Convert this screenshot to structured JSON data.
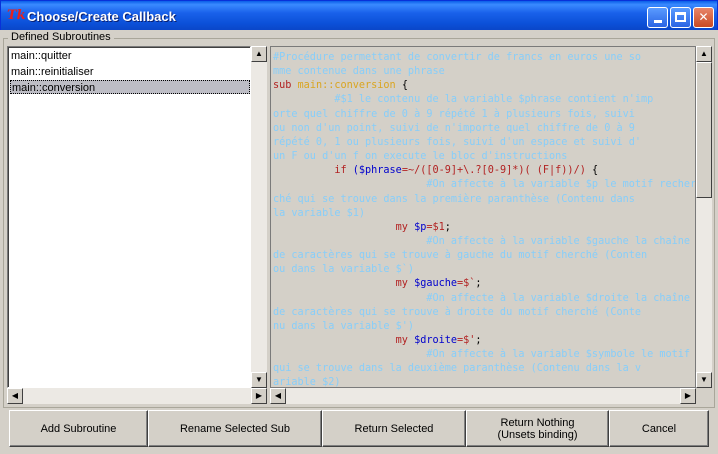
{
  "window": {
    "title": "Choose/Create Callback",
    "icon_text": "Tk",
    "controls": {
      "minimize": "minimize",
      "maximize": "maximize",
      "close": "✕"
    }
  },
  "frame": {
    "legend": "Defined Subroutines"
  },
  "subroutines": [
    {
      "label": "main::quitter",
      "selected": false
    },
    {
      "label": "main::reinitialiser",
      "selected": false
    },
    {
      "label": "main::conversion",
      "selected": true
    }
  ],
  "code": {
    "lines": [
      [
        [
          "c",
          "#Procédure permettant de convertir de francs en euros une so"
        ]
      ],
      [
        [
          "c",
          "mme contenue dans une phrase"
        ]
      ],
      [
        [
          "k",
          "sub "
        ],
        [
          "n",
          "main::conversion"
        ],
        [
          "p",
          " {"
        ]
      ],
      [
        [
          "c",
          "          #$1 le contenu de la variable $phrase contient n'imp"
        ]
      ],
      [
        [
          "c",
          "orte quel chiffre de 0 à 9 répété 1 à plusieurs fois, suivi"
        ]
      ],
      [
        [
          "c",
          "ou non d'un point, suivi de n'importe quel chiffre de 0 à 9"
        ]
      ],
      [
        [
          "c",
          "répété 0, 1 ou plusieurs fois, suivi d'un espace et suivi d'"
        ]
      ],
      [
        [
          "c",
          "un F ou d'un f on execute le bloc d'instructions"
        ]
      ],
      [
        [
          "p",
          "          "
        ],
        [
          "k",
          "if "
        ],
        [
          "v",
          "($phrase"
        ],
        [
          "k",
          "=~/([0-9]+\\.?[0-9]*)( (F|f))/) "
        ],
        [
          "p",
          "{"
        ]
      ],
      [
        [
          "c",
          "                         #On affecte à la variable $p le motif recher"
        ]
      ],
      [
        [
          "c",
          "ché qui se trouve dans la première paranthèse (Contenu dans"
        ]
      ],
      [
        [
          "c",
          "la variable $1)"
        ]
      ],
      [
        [
          "p",
          "                    "
        ],
        [
          "k",
          "my "
        ],
        [
          "v",
          "$p"
        ],
        [
          "k",
          "=$1"
        ],
        [
          "p",
          ";"
        ]
      ],
      [
        [
          "c",
          "                         #On affecte à la variable $gauche la chaîne"
        ]
      ],
      [
        [
          "c",
          "de caractères qui se trouve à gauche du motif cherché (Conten"
        ]
      ],
      [
        [
          "c",
          "ou dans la variable $`)"
        ]
      ],
      [
        [
          "p",
          "                    "
        ],
        [
          "k",
          "my "
        ],
        [
          "v",
          "$gauche"
        ],
        [
          "k",
          "=$`"
        ],
        [
          "p",
          ";"
        ]
      ],
      [
        [
          "c",
          "                         #On affecte à la variable $droite la chaîne"
        ]
      ],
      [
        [
          "c",
          "de caractères qui se trouve à droite du motif cherché (Conte"
        ]
      ],
      [
        [
          "c",
          "nu dans la variable $')"
        ]
      ],
      [
        [
          "p",
          "                    "
        ],
        [
          "k",
          "my "
        ],
        [
          "v",
          "$droite"
        ],
        [
          "k",
          "=$'"
        ],
        [
          "p",
          ";"
        ]
      ],
      [
        [
          "c",
          "                         #On affecte à la variable $symbole le motif"
        ]
      ],
      [
        [
          "c",
          "qui se trouve dans la deuxième paranthèse (Contenu dans la v"
        ]
      ],
      [
        [
          "c",
          "ariable $2)"
        ]
      ]
    ]
  },
  "buttons": {
    "add": "Add Subroutine",
    "rename": "Rename Selected Sub",
    "return_selected": "Return Selected",
    "return_nothing_line1": "Return Nothing",
    "return_nothing_line2": "(Unsets binding)",
    "cancel": "Cancel"
  },
  "colors": {
    "comment": "#87cefa",
    "keyword": "#b22222",
    "variable": "#0000cd",
    "sub_name": "#daa520",
    "title_bar": "#0b50d8",
    "dialog_bg": "#d4d0c8",
    "selection": "#bdbdc5"
  }
}
